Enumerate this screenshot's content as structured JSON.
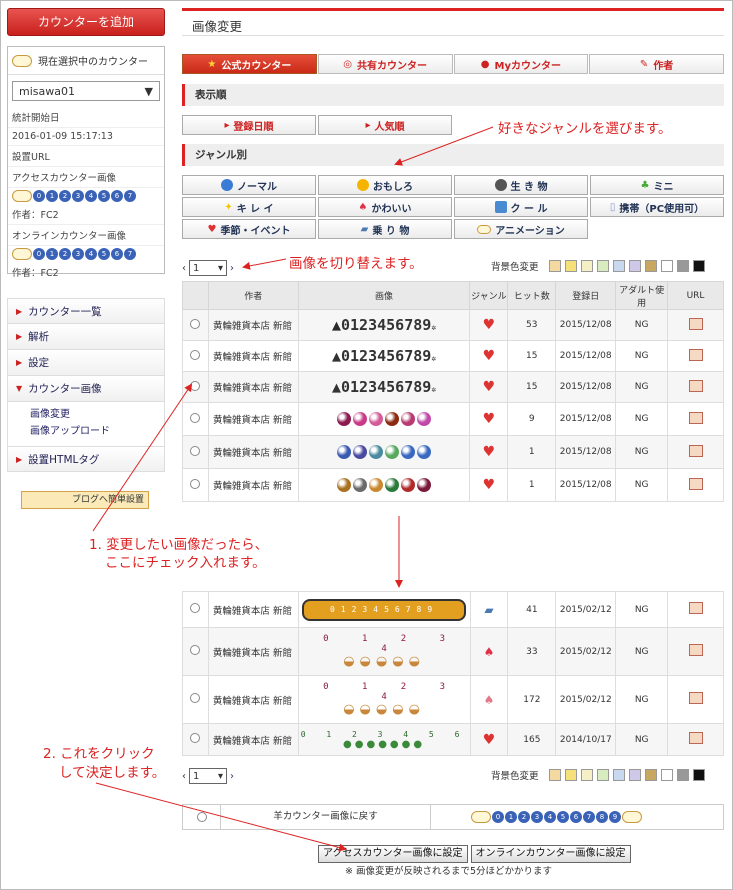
{
  "sidebar": {
    "add_counter": "カウンターを追加",
    "current_title": "現在選択中のカウンター",
    "current_select": "misawa01",
    "stats_start_label": "統計開始日",
    "stats_start_value": "2016-01-09 15:17:13",
    "install_url_label": "設置URL",
    "access_image_label": "アクセスカウンター画像",
    "access_author": "作者：FC2",
    "online_image_label": "オンラインカウンター画像",
    "online_author": "作者：FC2",
    "digits": [
      "0",
      "1",
      "2",
      "3",
      "4",
      "5",
      "6",
      "7"
    ],
    "menu": [
      {
        "label": "カウンター一覧"
      },
      {
        "label": "解析"
      },
      {
        "label": "設定"
      },
      {
        "label": "カウンター画像"
      }
    ],
    "submenu": [
      "画像変更",
      "画像アップロード"
    ],
    "menu_bottom": "設置HTMLタグ",
    "blog_button": "ブログへ簡単設置"
  },
  "main": {
    "title": "画像変更",
    "tabs": [
      {
        "label": "公式カウンター"
      },
      {
        "label": "共有カウンター"
      },
      {
        "label": "Myカウンター"
      },
      {
        "label": "作者"
      }
    ],
    "order_header": "表示順",
    "order_buttons": [
      "登録日順",
      "人気順"
    ],
    "genre_header": "ジャンル別",
    "genres": [
      {
        "label": "ノーマル",
        "color": "#3a7bd5"
      },
      {
        "label": "おもしろ",
        "color": "#f5b400"
      },
      {
        "label": "生 き 物",
        "color": "#555555"
      },
      {
        "label": "ミニ",
        "color": "#44aa33"
      },
      {
        "label": "キ レ イ",
        "color": "#f2c500"
      },
      {
        "label": "かわいい",
        "color": "#e0304a"
      },
      {
        "label": "ク ー ル",
        "color": "#4a8ad0"
      },
      {
        "label": "携帯（PC使用可）",
        "color": "#8899cc"
      },
      {
        "label": "季節・イベント",
        "color": "#e03030"
      },
      {
        "label": "乗 り 物",
        "color": "#4a7ab0"
      },
      {
        "label": "アニメーション",
        "color": "#d28a3a"
      }
    ],
    "page_value": "1",
    "bg_label": "背景色変更",
    "bg_swatches": [
      "#f4d9a0",
      "#f5e07a",
      "#f6f0c6",
      "#d8ecc0",
      "#c8d8ee",
      "#cfc8e8",
      "#c8a860",
      "#ffffff",
      "#999999",
      "#111111"
    ],
    "table": {
      "headers": [
        "作者",
        "画像",
        "ジャンル",
        "ヒット数",
        "登録日",
        "アダルト使用",
        "URL"
      ],
      "author": "黄輪雑貨本店 新館",
      "rows_top": [
        {
          "image": "0123456789",
          "hits": "53",
          "date": "2015/12/08",
          "adult": "NG"
        },
        {
          "image": "0123456789",
          "hits": "15",
          "date": "2015/12/08",
          "adult": "NG"
        },
        {
          "image": "0123456789",
          "hits": "15",
          "date": "2015/12/08",
          "adult": "NG"
        },
        {
          "image": "balls",
          "hits": "9",
          "date": "2015/12/08",
          "adult": "NG"
        },
        {
          "image": "balls",
          "hits": "1",
          "date": "2015/12/08",
          "adult": "NG"
        },
        {
          "image": "balls",
          "hits": "1",
          "date": "2015/12/08",
          "adult": "NG"
        }
      ],
      "rows_bottom": [
        {
          "image": "0123456789",
          "hits": "41",
          "date": "2015/02/12",
          "adult": "NG"
        },
        {
          "image": "0 1 2 3 4",
          "hits": "33",
          "date": "2015/02/12",
          "adult": "NG"
        },
        {
          "image": "0 1 2 3 4",
          "hits": "172",
          "date": "2015/02/12",
          "adult": "NG"
        },
        {
          "image": "0 1 2 3 4 5 6",
          "hits": "165",
          "date": "2014/10/17",
          "adult": "NG"
        }
      ]
    },
    "ball_colors_1": [
      "#8a1a50",
      "#c83a88",
      "#d45a9a",
      "#8a2a10",
      "#b83a70",
      "#c048a8"
    ],
    "ball_colors_2": [
      "#3a5ab0",
      "#4a4aa0",
      "#4a8aa0",
      "#58a860",
      "#3a68c0",
      "#3a6ac0"
    ],
    "ball_colors_3": [
      "#a87020",
      "#6a6a6a",
      "#c88830",
      "#2a7a3a",
      "#b02a2a",
      "#7a1a3a"
    ],
    "revert_label": "羊カウンター画像に戻す",
    "revert_digits": [
      "0",
      "1",
      "2",
      "3",
      "4",
      "5",
      "6",
      "7",
      "8",
      "9"
    ],
    "set_access_button": "アクセスカウンター画像に設定",
    "set_online_button": "オンラインカウンター画像に設定",
    "footnote": "※ 画像変更が反映されるまで5分ほどかかります"
  },
  "annotations": {
    "genre_note": "好きなジャンルを選びます。",
    "switch_note": "画像を切り替えます。",
    "check_note_1": "1. 変更したい画像だったら、",
    "check_note_2": "ここにチェック入れます。",
    "click_note_1": "2. これをクリック",
    "click_note_2": "して決定します。"
  }
}
